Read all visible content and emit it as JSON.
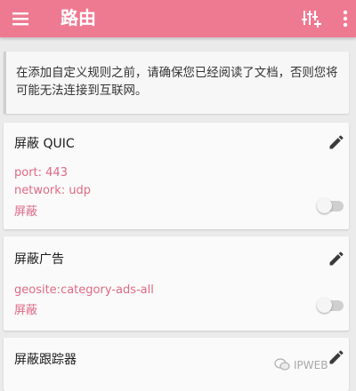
{
  "app_bar": {
    "title": "路由",
    "menu_icon": "menu-icon",
    "add_rule_icon": "add-rule-icon",
    "more_icon": "more-vert-icon",
    "color": "#ee7a92"
  },
  "notice": {
    "text": "在添加自定义规则之前，请确保您已经阅读了文档，否则您将可能无法连接到互联网。"
  },
  "rules": [
    {
      "name": "屏蔽 QUIC",
      "details": [
        "port: 443",
        "network: udp"
      ],
      "action": "屏蔽",
      "enabled": false
    },
    {
      "name": "屏蔽广告",
      "details": [
        "geosite:category-ads-all"
      ],
      "action": "屏蔽",
      "enabled": false
    },
    {
      "name": "屏蔽跟踪器",
      "details": [],
      "action": "",
      "enabled": false
    }
  ],
  "accent_text_color": "#e06a85",
  "watermark": {
    "text": "IPWEB"
  }
}
